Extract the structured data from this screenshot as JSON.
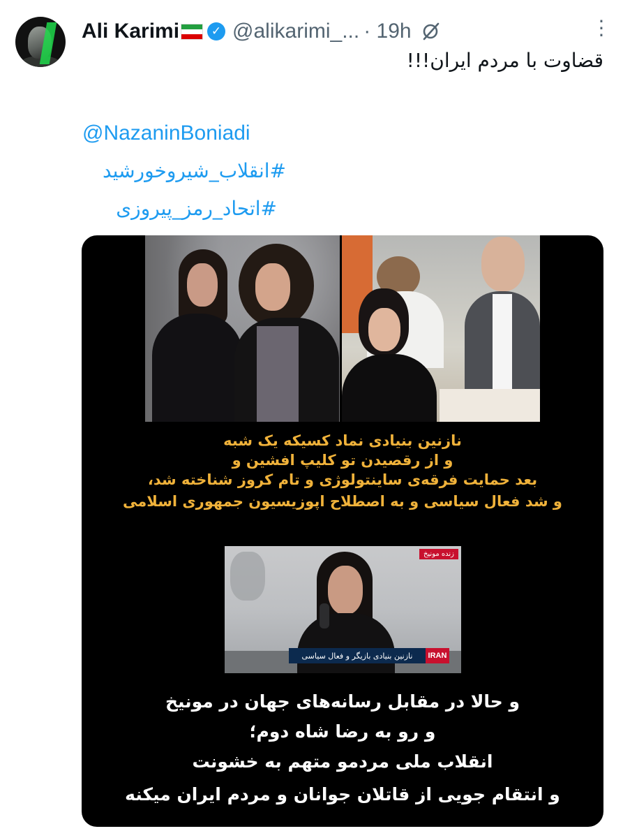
{
  "tweet": {
    "author_name": "Ali Karimi",
    "handle": "@alikarimi_...",
    "time": "· 19h",
    "text": "قضاوت با مردم ایران!!!",
    "mention": "@NazaninBoniadi",
    "hashtags": [
      "#انقلاب_شیروخورشید",
      "#اتحاد_رمز_پیروزی"
    ],
    "flag_colors": [
      "#239f40",
      "#ffffff",
      "#da0000"
    ],
    "accent_color": "#1d9bf0",
    "icons": [
      "verified-badge-icon",
      "grok-icon",
      "more-options-icon"
    ]
  },
  "media": {
    "gold_caption": [
      "نازنین بنیادی نماد کسیکه یک شبه",
      "و از رقصیدن تو کلیپ افشین و",
      "بعد حمایت فرقه‌ی ساینتولوژی و تام کروز شناخته شد،",
      "و شد فعال سیاسی و به اصطلاح اپوزیسیون جمهوری اسلامی"
    ],
    "white_caption": [
      "و حالا در مقابل رسانه‌های جهان در مونیخ",
      "و رو به رضا شاه دوم؛",
      "انقلاب ملی مردمو متهم به خشونت",
      "و انتقام جویی از قاتلان جوانان و مردم ایران میکنه"
    ],
    "tv_logo": "IRAN",
    "tv_lower_third": "نازنین بنیادی  بازیگر و فعال سیاسی",
    "tv_live_tag": "زنده  مونیخ"
  }
}
